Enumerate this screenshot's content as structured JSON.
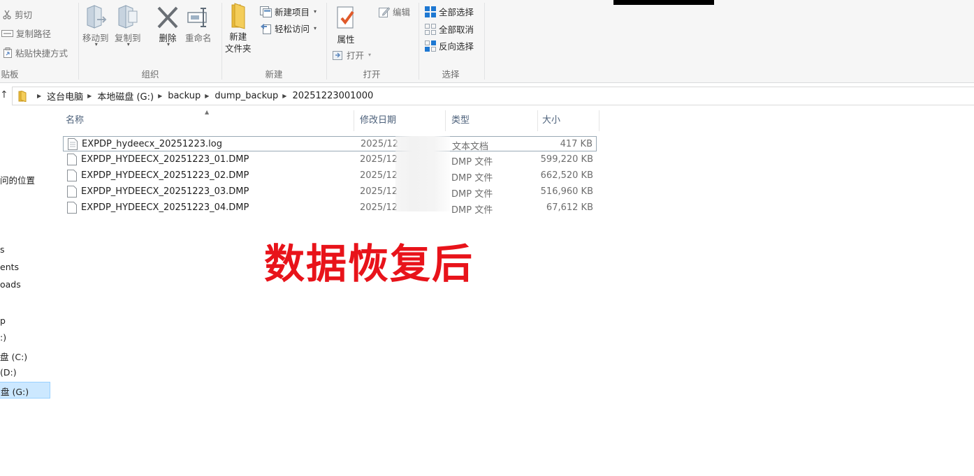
{
  "ribbon": {
    "clipboard": {
      "label": "贴板",
      "cut": "剪切",
      "copy_path": "复制路径",
      "paste_shortcut": "粘贴快捷方式"
    },
    "organize": {
      "label": "组织",
      "move_to": "移动到",
      "copy_to": "复制到",
      "delete": "删除",
      "rename": "重命名"
    },
    "new": {
      "label": "新建",
      "new_folder_line1": "新建",
      "new_folder_line2": "文件夹",
      "new_item": "新建项目",
      "easy_access": "轻松访问"
    },
    "open": {
      "label": "打开",
      "properties": "属性",
      "open": "打开",
      "edit": "编辑"
    },
    "select": {
      "label": "选择",
      "select_all": "全部选择",
      "select_none": "全部取消",
      "invert": "反向选择"
    }
  },
  "address": {
    "crumbs": [
      "这台电脑",
      "本地磁盘 (G:)",
      "backup",
      "dump_backup",
      "20251223001000"
    ]
  },
  "nav": {
    "items": [
      "问的位置",
      "s",
      "ents",
      "oads",
      "p",
      ":)",
      "盘 (C:)",
      "(D:)",
      "盘 (G:)"
    ]
  },
  "columns": {
    "name": "名称",
    "date": "修改日期",
    "type": "类型",
    "size": "大小"
  },
  "files": [
    {
      "name": "EXPDP_hydeecx_20251223.log",
      "date": "2025/12",
      "type": "文本文档",
      "size": "417 KB"
    },
    {
      "name": "EXPDP_HYDEECX_20251223_01.DMP",
      "date": "2025/12",
      "type": "DMP 文件",
      "size": "599,220 KB"
    },
    {
      "name": "EXPDP_HYDEECX_20251223_02.DMP",
      "date": "2025/12",
      "type": "DMP 文件",
      "size": "662,520 KB"
    },
    {
      "name": "EXPDP_HYDEECX_20251223_03.DMP",
      "date": "2025/12",
      "type": "DMP 文件",
      "size": "516,960 KB"
    },
    {
      "name": "EXPDP_HYDEECX_20251223_04.DMP",
      "date": "2025/12",
      "type": "DMP 文件",
      "size": "67,612 KB"
    }
  ],
  "caption": "数据恢复后",
  "colors": {
    "caption": "#e8131a",
    "selection_bg": "#cce8ff",
    "ribbon_bg": "#f6f6f6",
    "folder_yellow": "#e8b93a",
    "select_blue": "#1e78d2"
  }
}
